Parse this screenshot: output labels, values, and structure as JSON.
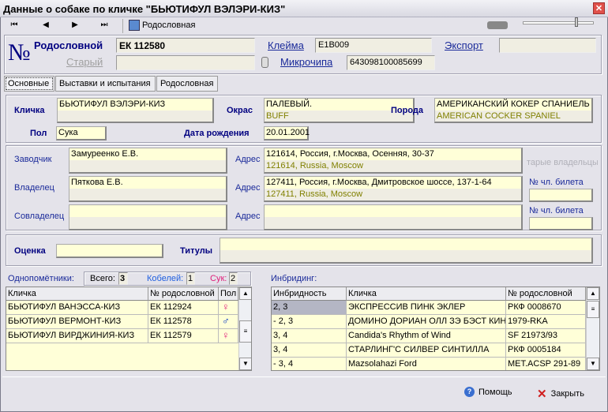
{
  "window": {
    "title": "Данные о собаке по кличке \"БЬЮТИФУЛ ВЭЛЭРИ-КИЗ\"",
    "close": "✕"
  },
  "toolbar": {
    "first": "⏮",
    "prev": "◀",
    "next": "▶",
    "last": "⏭",
    "pedigree": "Родословная",
    "slider_value": 0.85
  },
  "header": {
    "symbol": "№",
    "pedigree_label": "Родословной",
    "pedigree_value": "ЕК 112580",
    "brand_label": "Клейма",
    "brand_value": "E1B009",
    "export_label": "Экспорт",
    "export_value": "",
    "old_label": "Старый",
    "old_value": "",
    "chip_label": "Микрочипа",
    "chip_value": "643098100085699"
  },
  "tabs": [
    "Основные",
    "Выставки и испытания",
    "Родословная"
  ],
  "main": {
    "name_label": "Кличка",
    "name": "БЬЮТИФУЛ ВЭЛЭРИ-КИЗ",
    "name_en": "",
    "color_label": "Окрас",
    "color": "ПАЛЕВЫЙ.",
    "color_en": "BUFF",
    "breed_label": "Порода",
    "breed": "АМЕРИКАНСКИЙ КОКЕР СПАНИЕЛЬ",
    "breed_en": "AMERICAN COCKER SPANIEL",
    "sex_label": "Пол",
    "sex": "Сука",
    "dob_label": "Дата рождения",
    "dob": "20.01.2001"
  },
  "people": {
    "breeder_label": "Заводчик",
    "breeder": "Замуреенко Е.В.",
    "addr_label": "Адрес",
    "breeder_addr": "121614, Россия, г.Москва, Осенняя, 30-37",
    "breeder_addr_en": "121614, Russia, Moscow",
    "owner_label": "Владелец",
    "owner": "Пяткова Е.В.",
    "owner_addr": "127411, Россия, г.Москва, Дмитровское шоссе, 137-1-64",
    "owner_addr_en": "127411, Russia, Moscow",
    "coowner_label": "Совладелец",
    "coowner": "",
    "coowner_addr": "",
    "old_owners": "тарые владельцы",
    "member_label": "№ чл. билета",
    "owner_member": "",
    "coowner_member": ""
  },
  "eval": {
    "grade_label": "Оценка",
    "grade": "",
    "titles_label": "Титулы",
    "titles": ""
  },
  "litter": {
    "label": "Однопомётники:",
    "total_label": "Всего:",
    "total": "3",
    "males_label": "Кобелей:",
    "males": "1",
    "females_label": "Сук:",
    "females": "2",
    "columns": [
      "Кличка",
      "№ родословной",
      "Пол"
    ],
    "rows": [
      [
        "БЬЮТИФУЛ ВАНЭССА-КИЗ",
        "ЕК 112924",
        "♀"
      ],
      [
        "БЬЮТИФУЛ ВЕРМОНТ-КИЗ",
        "ЕК 112578",
        "♂"
      ],
      [
        "БЬЮТИФУЛ ВИРДЖИНИЯ-КИЗ",
        "ЕК 112579",
        "♀"
      ]
    ]
  },
  "inbreeding": {
    "label": "Инбридинг:",
    "columns": [
      "Инбридность",
      "Кличка",
      "№ родословной"
    ],
    "rows": [
      [
        "2, 3",
        "ЭКСПРЕССИВ ПИНК ЭКЛЕР",
        "РКФ 0008670"
      ],
      [
        " - 2, 3",
        "ДОМИНО ДОРИАН ОЛЛ ЗЭ БЭСТ КИНГ",
        "1979-RKA"
      ],
      [
        "3, 4",
        "Candida's Rhythm of Wind",
        "SF 21973/93"
      ],
      [
        "3, 4",
        "СТАРЛИНГ'С СИЛВЕР СИНТИЛЛА",
        "РКФ 0005184"
      ],
      [
        " - 3, 4",
        "Mazsolahazi Ford",
        "MET.ACSP 291-89"
      ]
    ]
  },
  "footer": {
    "help": "Помощь",
    "close": "Закрыть"
  },
  "colors": {
    "label": "#000080",
    "field": "#ffffd8",
    "field_alt": "#efede3",
    "english": "#808000",
    "female": "#e0207a",
    "male": "#0030c0"
  }
}
